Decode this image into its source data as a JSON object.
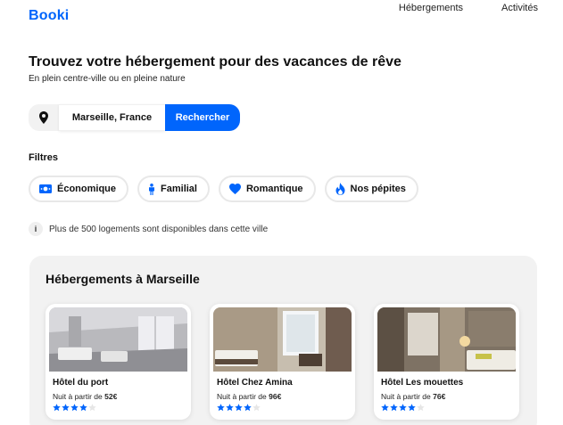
{
  "brand": {
    "logo": "Booki",
    "color": "#0065fc"
  },
  "nav": {
    "items": [
      "Hébergements",
      "Activités"
    ]
  },
  "hero": {
    "title": "Trouvez votre hébergement pour des vacances de rêve",
    "subtitle": "En plein centre-ville ou en pleine nature"
  },
  "search": {
    "icon": "location-pin-icon",
    "city": "Marseille, France",
    "button": "Rechercher"
  },
  "filters": {
    "title": "Filtres",
    "items": [
      {
        "label": "Économique",
        "icon": "money-icon"
      },
      {
        "label": "Familial",
        "icon": "person-icon"
      },
      {
        "label": "Romantique",
        "icon": "heart-icon"
      },
      {
        "label": "Nos pépites",
        "icon": "fire-icon"
      }
    ]
  },
  "info": {
    "icon": "info-icon",
    "glyph": "i",
    "text": "Plus de 500 logements sont disponibles dans cette ville"
  },
  "listings": {
    "title": "Hébergements à Marseille",
    "cards": [
      {
        "name": "Hôtel du port",
        "price_prefix": "Nuit à partir de",
        "price": "52€",
        "rating": 4,
        "max_rating": 5
      },
      {
        "name": "Hôtel Chez Amina",
        "price_prefix": "Nuit à partir de",
        "price": "96€",
        "rating": 4,
        "max_rating": 5
      },
      {
        "name": "Hôtel Les mouettes",
        "price_prefix": "Nuit à partir de",
        "price": "76€",
        "rating": 4,
        "max_rating": 5
      }
    ]
  }
}
